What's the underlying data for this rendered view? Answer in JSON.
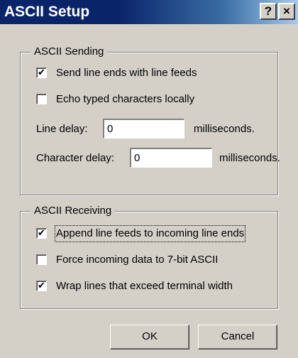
{
  "window": {
    "title": "ASCII Setup",
    "help_button": "?",
    "close_button": "×"
  },
  "sending": {
    "legend": "ASCII Sending",
    "send_line_ends": {
      "label": "Send line ends with line feeds",
      "checked": true
    },
    "echo_locally": {
      "label": "Echo typed characters locally",
      "checked": false
    },
    "line_delay": {
      "label": "Line delay:",
      "value": "0",
      "unit": "milliseconds."
    },
    "character_delay": {
      "label": "Character delay:",
      "value": "0",
      "unit": "milliseconds."
    }
  },
  "receiving": {
    "legend": "ASCII Receiving",
    "append_line_feeds": {
      "label": "Append line feeds to incoming line ends",
      "checked": true
    },
    "force_7bit": {
      "label": "Force incoming data to 7-bit ASCII",
      "checked": false
    },
    "wrap_lines": {
      "label": "Wrap lines that exceed terminal width",
      "checked": true
    }
  },
  "buttons": {
    "ok": "OK",
    "cancel": "Cancel"
  },
  "colors": {
    "titlebar_start": "#0a246a",
    "titlebar_end": "#a6caf0",
    "dialog_face": "#d4d0c8"
  }
}
